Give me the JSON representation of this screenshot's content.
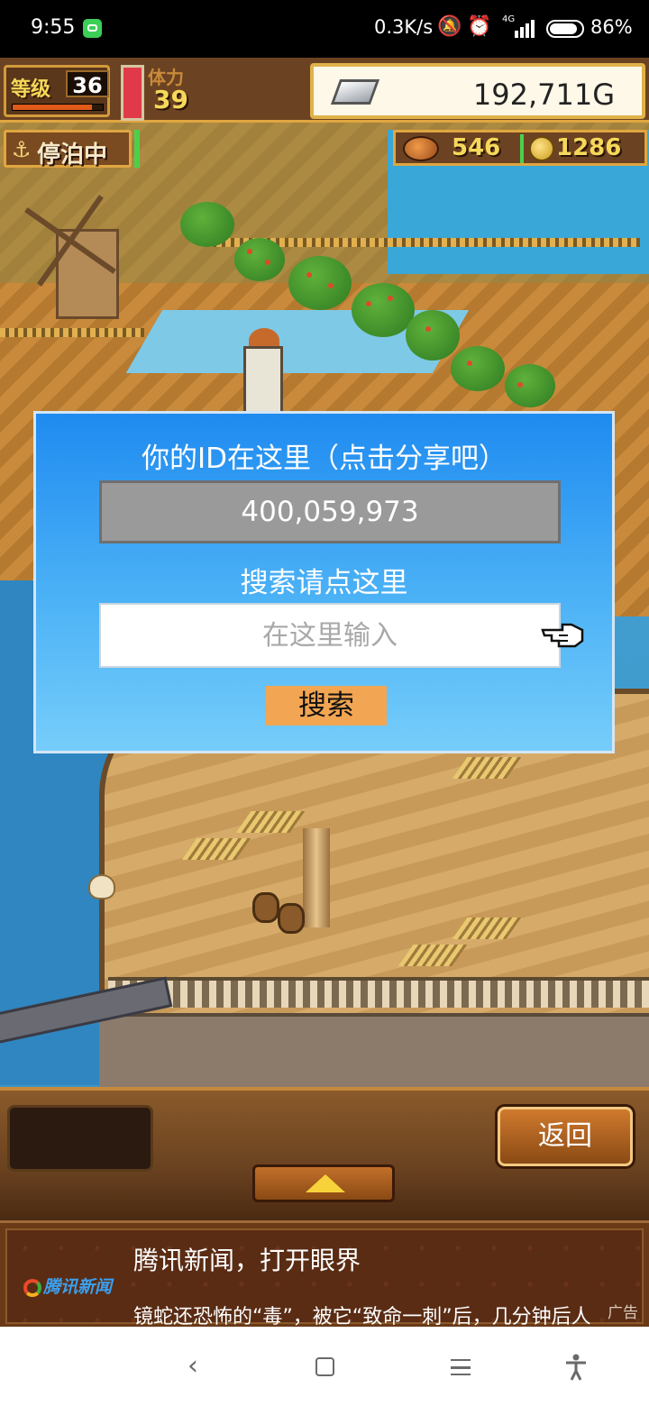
{
  "status_bar": {
    "time": "9:55",
    "network_speed": "0.3K/s",
    "icons": [
      "app-notification-icon",
      "mute-bell-icon",
      "alarm-icon",
      "4g-signal-icon",
      "battery-icon"
    ],
    "battery_percent": "86%",
    "battery_level": 0.86
  },
  "hud": {
    "level_label": "等级",
    "level_value": "36",
    "stamina_label": "体力",
    "stamina_value": "39",
    "gold_value": "192,711G",
    "docked_label": "停泊中",
    "food_value": "546",
    "coin_value": "1286"
  },
  "dialog": {
    "id_title": "你的ID在这里（点击分享吧）",
    "id_value": "400,059,973",
    "search_title": "搜索请点这里",
    "search_placeholder": "在这里输入",
    "search_button": "搜索"
  },
  "bottom_bar": {
    "back_label": "返回"
  },
  "ad": {
    "logo_text": "腾讯新闻",
    "title": "腾讯新闻，打开眼界",
    "description": "镜蛇还恐怖的“毒”，被它“致命一刺”后，几分钟后人",
    "tag": "广告"
  },
  "colors": {
    "dialog_top": "#1f8bf0",
    "dialog_bottom": "#76cdfa",
    "search_button": "#f2a552",
    "hud_wood": "#6b4322",
    "accent_gold": "#e0a640"
  }
}
